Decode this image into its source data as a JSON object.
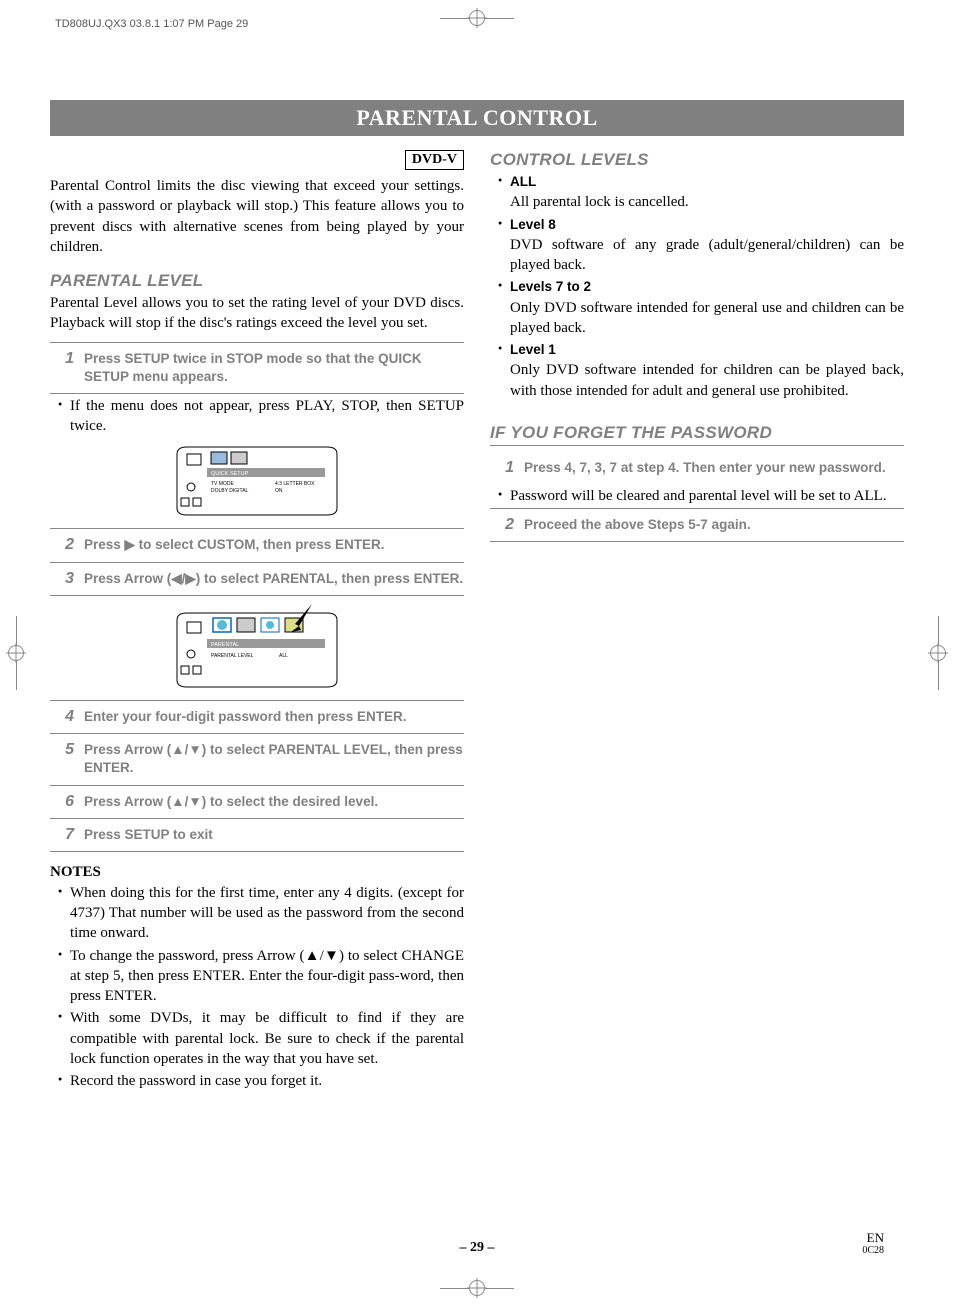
{
  "print_header": "TD808UJ.QX3  03.8.1 1:07 PM  Page 29",
  "title": "PARENTAL CONTROL",
  "badge": "DVD-V",
  "intro": "Parental Control limits the disc viewing that exceed your settings. (with a password or playback will stop.) This feature allows you to prevent discs with alternative scenes from being played by your children.",
  "sec1_head": "PARENTAL LEVEL",
  "sec1_body": "Parental Level allows you to set the rating level of your DVD discs. Playback will stop if the disc's ratings exceed the level you set.",
  "steps": [
    "Press SETUP twice in STOP mode so that the QUICK SETUP menu appears.",
    "Press ▶ to select CUSTOM, then press ENTER.",
    "Press Arrow (◀/▶) to select PARENTAL, then press ENTER.",
    "Enter your four-digit password then press ENTER.",
    "Press Arrow (▲/▼) to select PARENTAL LEVEL, then press ENTER.",
    "Press Arrow (▲/▼) to select the desired level.",
    "Press SETUP to exit"
  ],
  "step1_note": "If the menu does not appear, press PLAY, STOP, then SETUP twice.",
  "diagram1": {
    "tab": "QUICK SETUP",
    "row1": "TV MODE          4:3 LETTER BOX",
    "row2": "DOLBY DIGITAL    ON"
  },
  "diagram2": {
    "tab": "PARENTAL",
    "row1": "PARENTAL LEVEL    ALL"
  },
  "notes_head": "NOTES",
  "notes": [
    "When doing this for the first time, enter any 4 digits. (except for 4737) That number will be used as the password from the second time onward.",
    "To change the password, press Arrow (▲/▼) to select CHANGE at step 5, then press ENTER. Enter the four-digit pass-word, then press ENTER.",
    "With some DVDs, it may be difficult to find if they are compatible with parental lock. Be sure to check if the parental lock function operates in the way that you have set.",
    "Record the password in case you forget it."
  ],
  "sec2_head": "CONTROL LEVELS",
  "levels": [
    {
      "label": "ALL",
      "desc": "All parental lock is cancelled."
    },
    {
      "label": "Level 8",
      "desc": "DVD software of any grade (adult/general/children) can be played back."
    },
    {
      "label": "Levels 7 to 2",
      "desc": "Only DVD software intended for general use and children can be played back."
    },
    {
      "label": "Level 1",
      "desc": "Only DVD software intended for children can be played back, with those intended for adult and general use prohibited."
    }
  ],
  "sec3_head": "IF YOU FORGET THE PASSWORD",
  "forgot_step1": "Press 4, 7, 3, 7 at step 4. Then enter your new password.",
  "forgot_note": "Password will be cleared and parental level will be set to ALL.",
  "forgot_step2": "Proceed the above Steps 5-7 again.",
  "page_number": "– 29 –",
  "doc_code": "EN",
  "doc_sub": "0C28"
}
